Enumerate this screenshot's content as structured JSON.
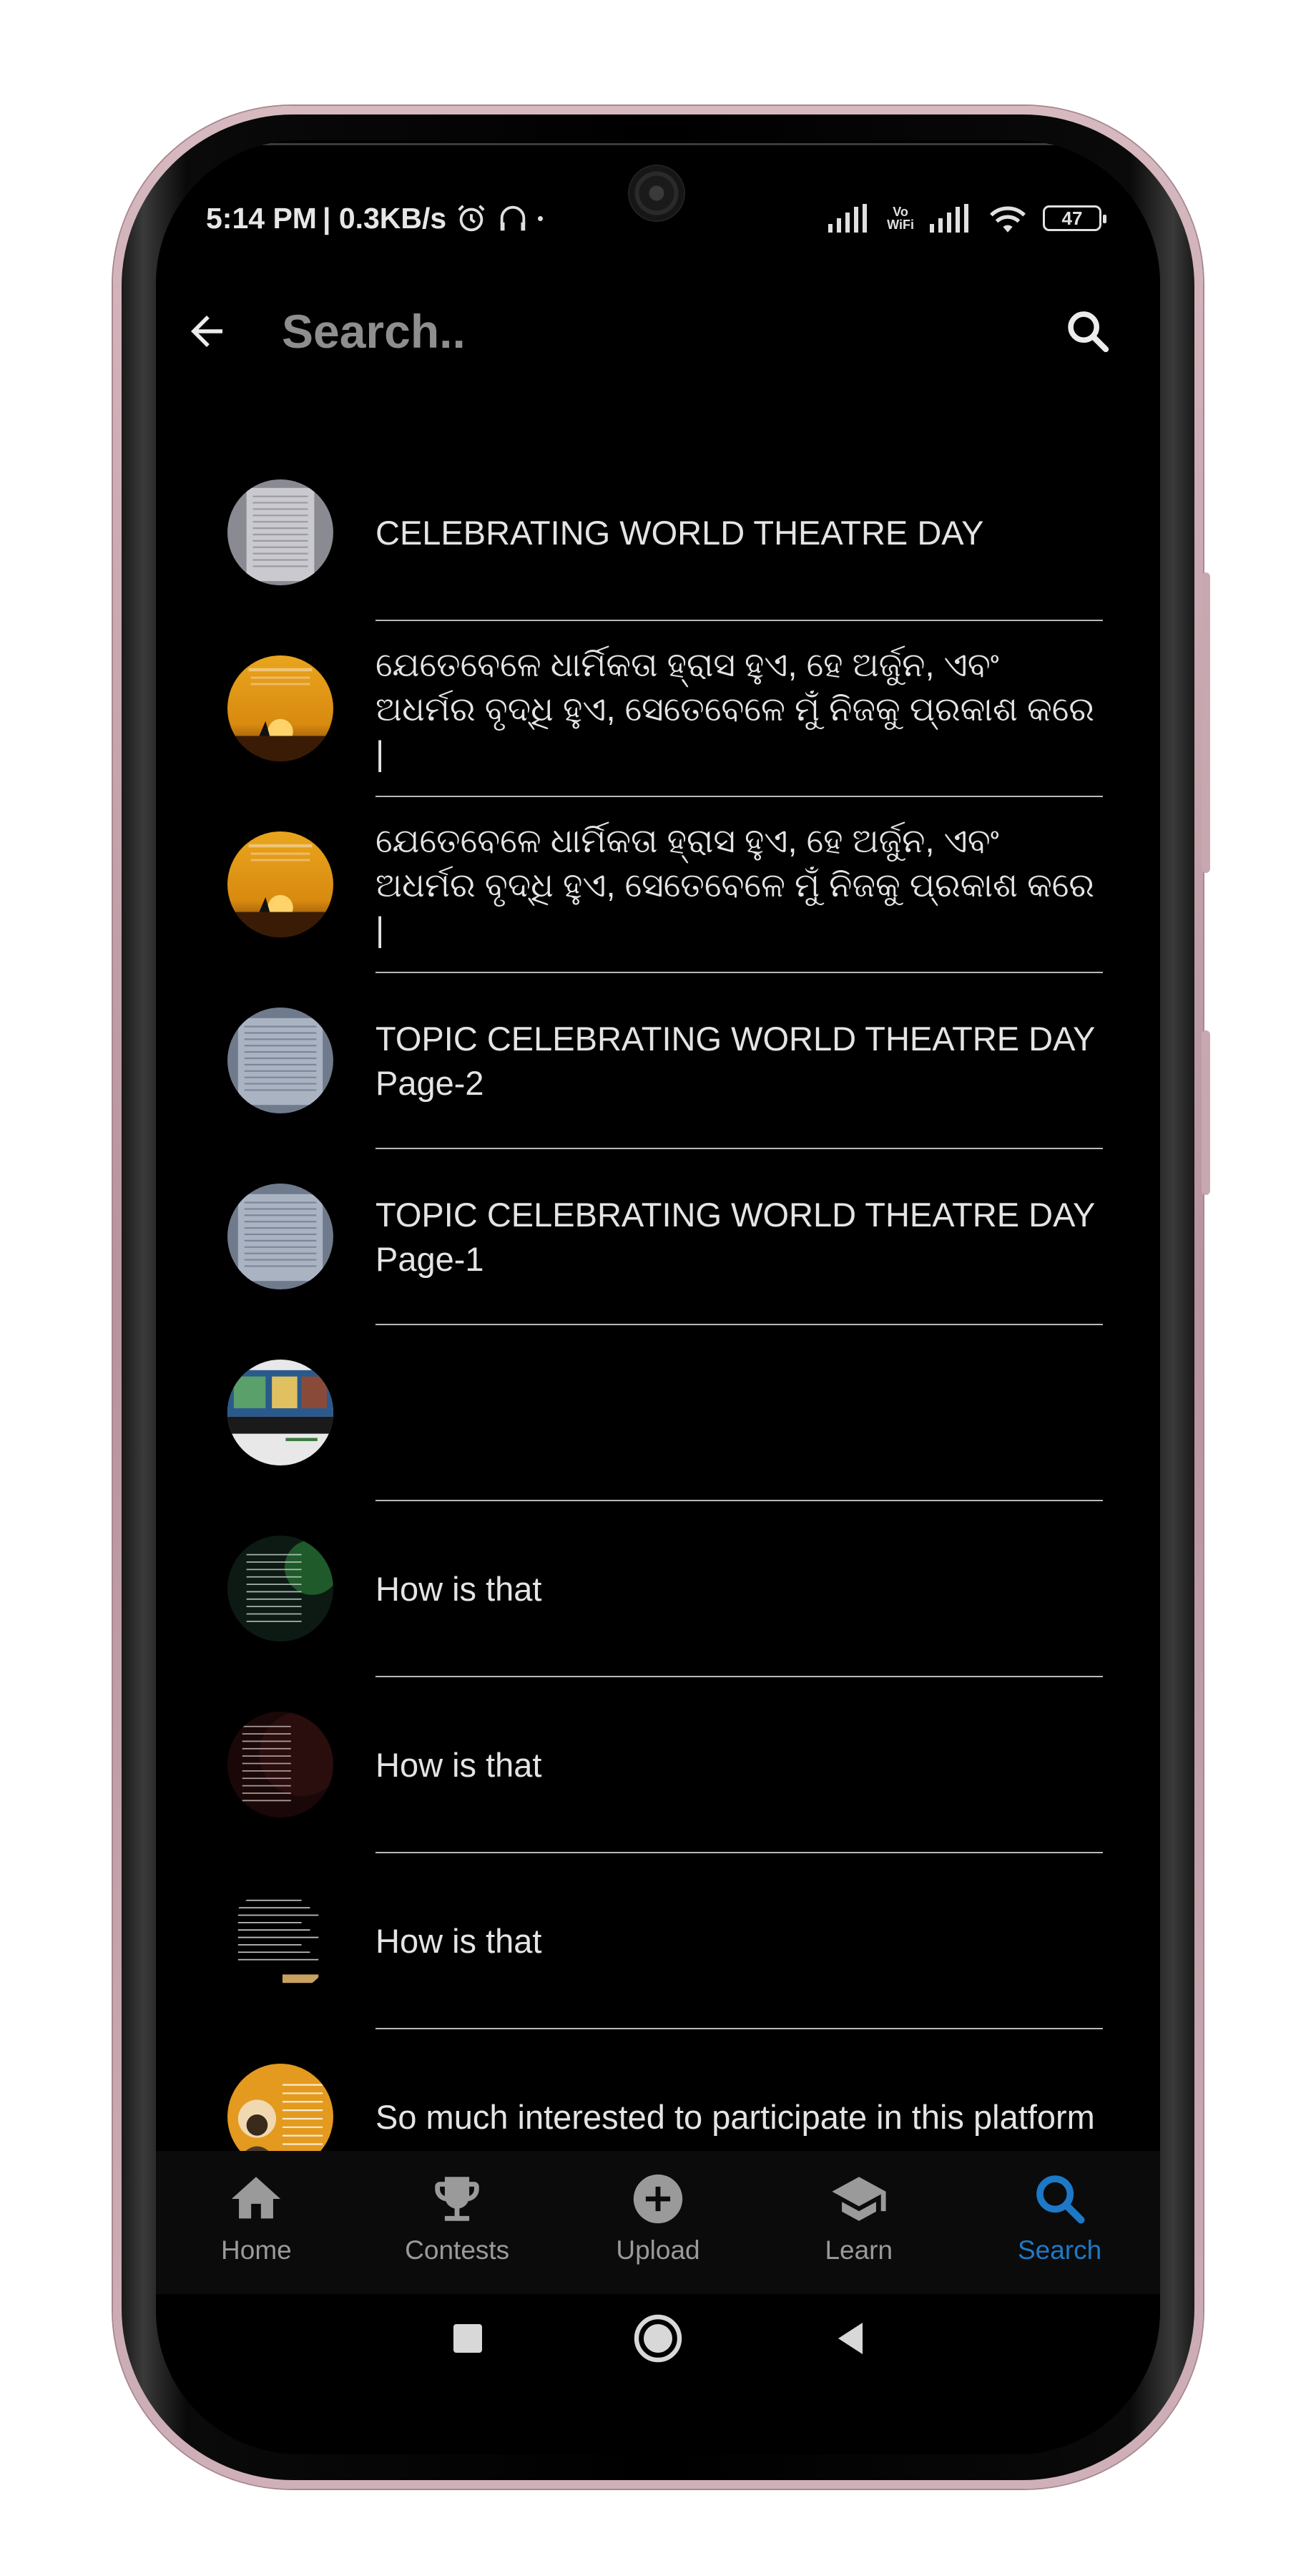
{
  "status_bar": {
    "time": "5:14 PM",
    "speed": "| 0.3KB/s",
    "vowifi_top": "Vo",
    "vowifi_bottom": "WiFi",
    "battery": "47"
  },
  "search": {
    "placeholder": "Search..",
    "value": ""
  },
  "results": [
    {
      "text": "CELEBRATING WORLD THEATRE DAY",
      "thumb": "paper"
    },
    {
      "text": "ଯେତେବେଳେ ଧାର୍ମିକତା ହ୍ରାସ ହୁଏ, ହେ ଅର୍ଜୁନ, ଏବଂ ଅଧର୍ମର ବୃଦ୍ଧି ହୁଏ, ସେତେବେଳେ ମୁଁ ନିଜକୁ ପ୍ରକାଶ କରେ |",
      "thumb": "sunset"
    },
    {
      "text": "ଯେତେବେଳେ ଧାର୍ମିକତା ହ୍ରାସ ହୁଏ, ହେ ଅର୍ଜୁନ, ଏବଂ ଅଧର୍ମର ବୃଦ୍ଧି ହୁଏ, ସେତେବେଳେ ମୁଁ ନିଜକୁ ପ୍ରକାଶ କରେ |",
      "thumb": "sunset"
    },
    {
      "text": "TOPIC CELEBRATING WORLD THEATRE DAY Page-2",
      "thumb": "paper-blue"
    },
    {
      "text": "TOPIC CELEBRATING WORLD THEATRE DAY Page-1",
      "thumb": "paper-blue"
    },
    {
      "text": "",
      "thumb": "banner"
    },
    {
      "text": "How is that",
      "thumb": "green-dark"
    },
    {
      "text": "How is that",
      "thumb": "red-dark"
    },
    {
      "text": "How is that",
      "thumb": "text-dark"
    },
    {
      "text": "So much interested to participate in this platform",
      "thumb": "portrait-orange"
    }
  ],
  "nav": [
    {
      "label": "Home",
      "icon": "home-icon"
    },
    {
      "label": "Contests",
      "icon": "trophy-icon"
    },
    {
      "label": "Upload",
      "icon": "add-circle-icon"
    },
    {
      "label": "Learn",
      "icon": "school-icon"
    },
    {
      "label": "Search",
      "icon": "search-icon",
      "active": true
    }
  ],
  "colors": {
    "accent": "#1d79c7",
    "background": "#000000",
    "text": "#e4e4e4"
  }
}
